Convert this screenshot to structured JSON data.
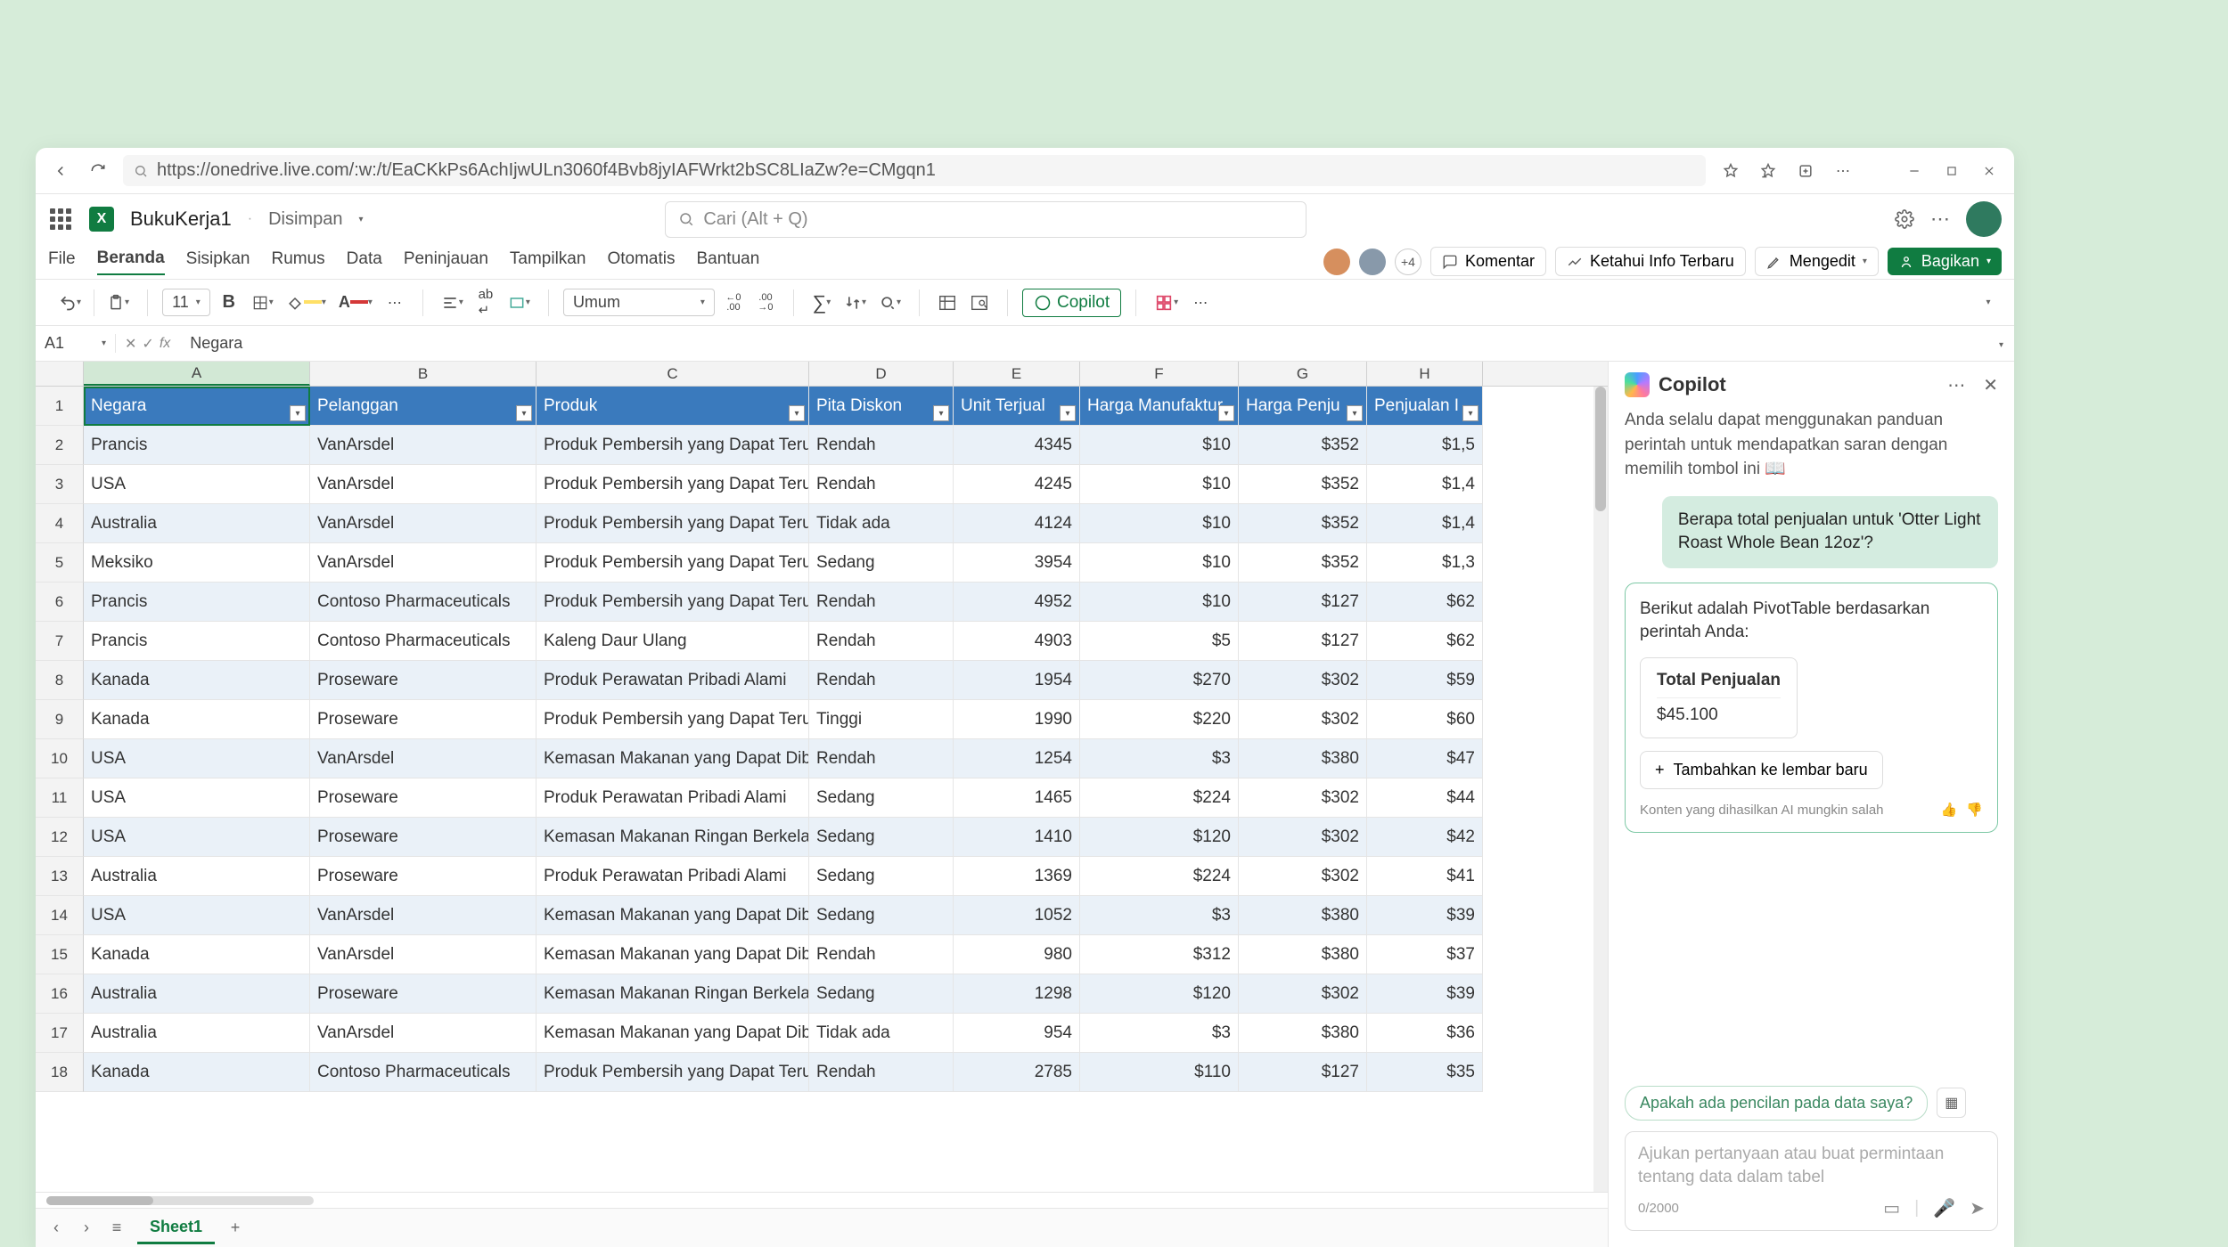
{
  "browser": {
    "url": "https://onedrive.live.com/:w:/t/EaCKkPs6AchIjwULn3060f4Bvb8jyIAFWrkt2bSC8LIaZw?e=CMgqn1"
  },
  "header": {
    "doc_title": "BukuKerja1",
    "doc_status": "Disimpan",
    "search_placeholder": "Cari (Alt + Q)"
  },
  "tabs": {
    "items": [
      "File",
      "Beranda",
      "Sisipkan",
      "Rumus",
      "Data",
      "Peninjauan",
      "Tampilkan",
      "Otomatis",
      "Bantuan"
    ],
    "active_index": 1,
    "collab_count": "+4",
    "comments": "Komentar",
    "whatsnew": "Ketahui Info Terbaru",
    "editing": "Mengedit",
    "share": "Bagikan"
  },
  "ribbon": {
    "font_size": "11",
    "number_format": "Umum",
    "copilot_btn": "Copilot"
  },
  "fx": {
    "name_box": "A1",
    "formula": "Negara"
  },
  "columns": [
    "A",
    "B",
    "C",
    "D",
    "E",
    "F",
    "G",
    "H"
  ],
  "col_widths": [
    "cw-A",
    "cw-B",
    "cw-C",
    "cw-D",
    "cw-E",
    "cw-F",
    "cw-G",
    "cw-H"
  ],
  "table": {
    "headers": [
      "Negara",
      "Pelanggan",
      "Produk",
      "Pita Diskon",
      "Unit Terjual",
      "Harga Manufaktur",
      "Harga Penju",
      "Penjualan I"
    ],
    "rows": [
      [
        "Prancis",
        "VanArsdel",
        "Produk Pembersih yang Dapat Teru",
        "Rendah",
        "4345",
        "$10",
        "$352",
        "$1,5"
      ],
      [
        "USA",
        "VanArsdel",
        "Produk Pembersih yang Dapat Teru",
        "Rendah",
        "4245",
        "$10",
        "$352",
        "$1,4"
      ],
      [
        "Australia",
        "VanArsdel",
        "Produk Pembersih yang Dapat Teru",
        "Tidak ada",
        "4124",
        "$10",
        "$352",
        "$1,4"
      ],
      [
        "Meksiko",
        "VanArsdel",
        "Produk Pembersih yang Dapat Teru",
        "Sedang",
        "3954",
        "$10",
        "$352",
        "$1,3"
      ],
      [
        "Prancis",
        "Contoso Pharmaceuticals",
        "Produk Pembersih yang Dapat Teru",
        "Rendah",
        "4952",
        "$10",
        "$127",
        "$62"
      ],
      [
        "Prancis",
        "Contoso Pharmaceuticals",
        "Kaleng Daur Ulang",
        "Rendah",
        "4903",
        "$5",
        "$127",
        "$62"
      ],
      [
        "Kanada",
        "Proseware",
        "Produk Perawatan Pribadi Alami",
        "Rendah",
        "1954",
        "$270",
        "$302",
        "$59"
      ],
      [
        "Kanada",
        "Proseware",
        "Produk Pembersih yang Dapat Teru",
        "Tinggi",
        "1990",
        "$220",
        "$302",
        "$60"
      ],
      [
        "USA",
        "VanArsdel",
        "Kemasan Makanan yang Dapat Dib",
        "Rendah",
        "1254",
        "$3",
        "$380",
        "$47"
      ],
      [
        "USA",
        "Proseware",
        "Produk Perawatan Pribadi Alami",
        "Sedang",
        "1465",
        "$224",
        "$302",
        "$44"
      ],
      [
        "USA",
        "Proseware",
        "Kemasan Makanan Ringan Berkela",
        "Sedang",
        "1410",
        "$120",
        "$302",
        "$42"
      ],
      [
        "Australia",
        "Proseware",
        "Produk Perawatan Pribadi Alami",
        "Sedang",
        "1369",
        "$224",
        "$302",
        "$41"
      ],
      [
        "USA",
        "VanArsdel",
        "Kemasan Makanan yang Dapat Dib",
        "Sedang",
        "1052",
        "$3",
        "$380",
        "$39"
      ],
      [
        "Kanada",
        "VanArsdel",
        "Kemasan Makanan yang Dapat Dib",
        "Rendah",
        "980",
        "$312",
        "$380",
        "$37"
      ],
      [
        "Australia",
        "Proseware",
        "Kemasan Makanan Ringan Berkela",
        "Sedang",
        "1298",
        "$120",
        "$302",
        "$39"
      ],
      [
        "Australia",
        "VanArsdel",
        "Kemasan Makanan yang Dapat Dib",
        "Tidak ada",
        "954",
        "$3",
        "$380",
        "$36"
      ],
      [
        "Kanada",
        "Contoso Pharmaceuticals",
        "Produk Pembersih yang Dapat Teru",
        "Rendah",
        "2785",
        "$110",
        "$127",
        "$35"
      ]
    ]
  },
  "copilot": {
    "title": "Copilot",
    "hint": "Anda selalu dapat menggunakan panduan perintah untuk mendapatkan saran dengan memilih tombol ini",
    "user_msg": "Berapa total penjualan untuk 'Otter Light Roast Whole Bean 12oz'?",
    "reply_intro": "Berikut adalah PivotTable berdasarkan perintah Anda:",
    "pivot_title": "Total Penjualan",
    "pivot_value": "$45.100",
    "action": "Tambahkan ke lembar baru",
    "disclaimer": "Konten yang dihasilkan AI mungkin salah",
    "suggestion": "Apakah ada pencilan pada data saya?",
    "input_placeholder": "Ajukan pertanyaan atau buat permintaan tentang data dalam tabel",
    "counter": "0/2000"
  },
  "footer": {
    "sheet_name": "Sheet1"
  }
}
